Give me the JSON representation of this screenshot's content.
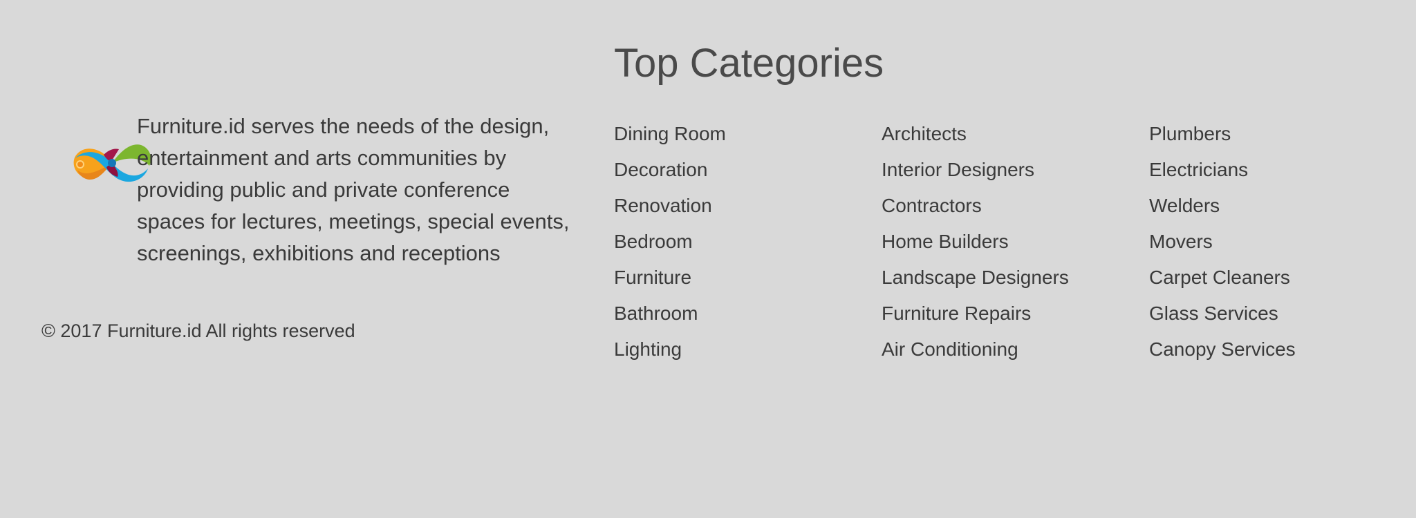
{
  "about": {
    "logo_name": "furniture-id-logo",
    "description": "Furniture.id serves the needs of the design, entertainment and arts communities by providing public and private conference spaces for lectures, meetings, special events, screenings, exhibitions and receptions"
  },
  "copyright": "© 2017 Furniture.id All rights reserved",
  "categories": {
    "title": "Top Categories",
    "columns": [
      [
        "Dining Room",
        "Decoration",
        "Renovation",
        "Bedroom",
        "Furniture",
        "Bathroom",
        "Lighting"
      ],
      [
        "Architects",
        "Interior Designers",
        "Contractors",
        "Home Builders",
        "Landscape Designers",
        "Furniture Repairs",
        "Air Conditioning"
      ],
      [
        "Plumbers",
        "Electricians",
        "Welders",
        "Movers",
        "Carpet Cleaners",
        "Glass Services",
        "Canopy Services"
      ]
    ]
  },
  "colors": {
    "background": "#d9d9d9",
    "text": "#3a3a3a",
    "title": "#4a4a4a"
  }
}
